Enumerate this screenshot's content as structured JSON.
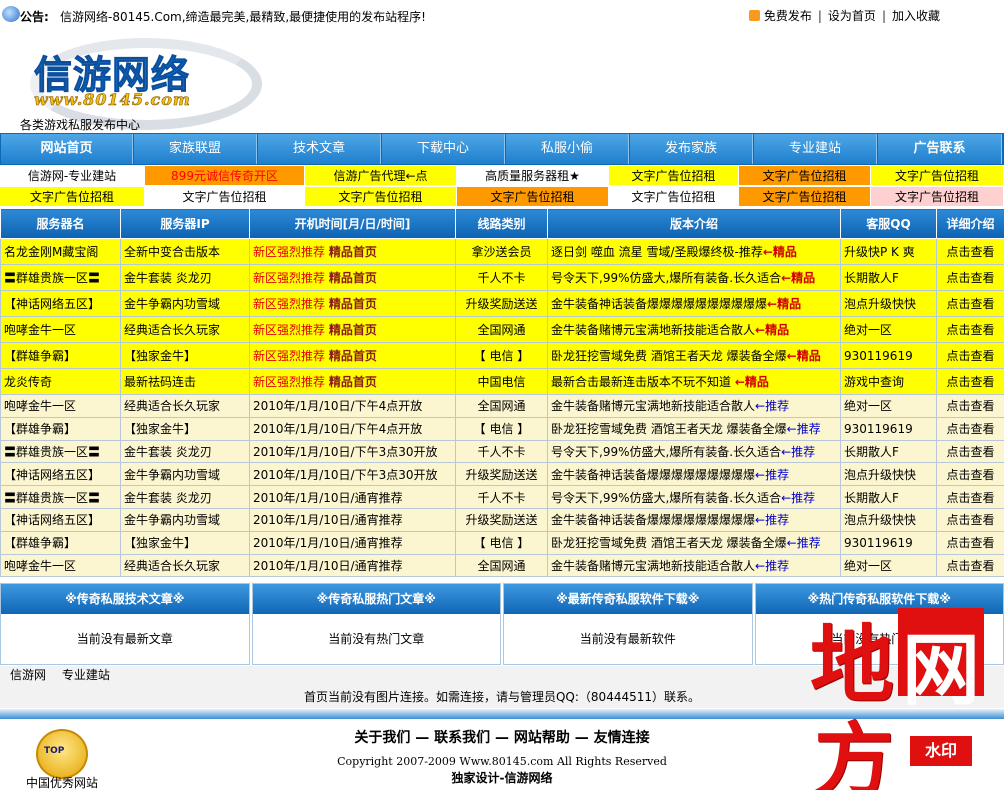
{
  "topbar": {
    "notice_label": "公告:",
    "notice_text": "信游网络-80145.Com,缔造最完美,最精致,最便捷使用的发布站程序!",
    "links": [
      "免费发布",
      "设为首页",
      "加入收藏"
    ]
  },
  "logo": {
    "name": "信游网络",
    "url": "www.80145.com",
    "slogan": "各类游戏私服发布中心"
  },
  "nav": [
    "网站首页",
    "家族联盟",
    "技术文章",
    "下载中心",
    "私服小偷",
    "发布家族",
    "专业建站",
    "广告联系"
  ],
  "ads": {
    "row1": [
      {
        "label": "信游网-专业建站",
        "bg": "#ffffff",
        "color": "#000000"
      },
      {
        "label": "899元诚信传奇开区",
        "bg": "#ff9900",
        "color": "#ff0000"
      },
      {
        "label": "信游广告代理←点",
        "bg": "#ffff00",
        "color": "#000000"
      },
      {
        "label": "高质量服务器租★",
        "bg": "#ffffff",
        "color": "#000000"
      },
      {
        "label": "文字广告位招租",
        "bg": "#ffff00",
        "color": "#000000"
      },
      {
        "label": "文字广告位招租",
        "bg": "#ff9900",
        "color": "#000000"
      },
      {
        "label": "文字广告位招租",
        "bg": "#ffff00",
        "color": "#000000"
      }
    ],
    "row2": [
      {
        "label": "文字广告位招租",
        "bg": "#ffff00",
        "color": "#000000"
      },
      {
        "label": "文字广告位招租",
        "bg": "#ffffff",
        "color": "#000000"
      },
      {
        "label": "文字广告位招租",
        "bg": "#ffff00",
        "color": "#000000"
      },
      {
        "label": "文字广告位招租",
        "bg": "#ff9900",
        "color": "#000000"
      },
      {
        "label": "文字广告位招租",
        "bg": "#ffffff",
        "color": "#000000"
      },
      {
        "label": "文字广告位招租",
        "bg": "#ff9900",
        "color": "#000000"
      },
      {
        "label": "文字广告位招租",
        "bg": "#ffd0d0",
        "color": "#000000"
      }
    ]
  },
  "table": {
    "headers": [
      "服务器名",
      "服务器IP",
      "开机时间[月/日/时间]",
      "线路类别",
      "版本介绍",
      "客服QQ",
      "详细介绍"
    ],
    "vip_rows": [
      {
        "name": "名龙金刚M藏宝阁",
        "ip": "全新中变合击版本",
        "time_a": "新区强烈推荐",
        "time_b": "精品首页",
        "line": "拿沙送会员",
        "intro": "逐日剑 噬血 流星 雪域/圣殿爆终极-推荐",
        "intro_tag": "←精品",
        "qq": "升级快P K 爽",
        "detail": "点击查看"
      },
      {
        "name": "〓群雄贵族一区〓",
        "ip": "金牛套装 炎龙刃",
        "time_a": "新区强烈推荐",
        "time_b": "精品首页",
        "line": "千人不卡",
        "intro": "号令天下,99%仿盛大,爆所有装备.长久适合",
        "intro_tag": "←精品",
        "qq": "长期散人F",
        "detail": "点击查看"
      },
      {
        "name": "【神话网络五区】",
        "ip": "金牛争霸内功雪域",
        "time_a": "新区强烈推荐",
        "time_b": "精品首页",
        "line": "升级奖励送送",
        "intro": "金牛装备神话装备爆爆爆爆爆爆爆爆爆爆",
        "intro_tag": "←精品",
        "qq": "泡点升级快快",
        "detail": "点击查看"
      },
      {
        "name": "咆哮金牛一区",
        "ip": "经典适合长久玩家",
        "time_a": "新区强烈推荐",
        "time_b": "精品首页",
        "line": "全国网通",
        "intro": "金牛装备赌博元宝满地新技能适合散人",
        "intro_tag": "←精品",
        "qq": "绝对一区",
        "detail": "点击查看"
      },
      {
        "name": "【群雄争霸】",
        "ip": "【独家金牛】",
        "time_a": "新区强烈推荐",
        "time_b": "精品首页",
        "line": "【 电信 】",
        "intro": "卧龙狂挖雪域免费 酒馆王者天龙 爆装备全爆",
        "intro_tag": "←精品",
        "qq": "930119619",
        "detail": "点击查看"
      },
      {
        "name": "龙炎传奇",
        "ip": "最新祛码连击",
        "time_a": "新区强烈推荐",
        "time_b": "精品首页",
        "line": "中国电信",
        "intro": "最新合击最新连击版本不玩不知道 ",
        "intro_tag": "←精品",
        "qq": "游戏中查询",
        "detail": "点击查看"
      }
    ],
    "normal_rows": [
      {
        "name": "咆哮金牛一区",
        "ip": "经典适合长久玩家",
        "time": "2010年/1月/10日/下午4点开放",
        "line": "全国网通",
        "intro": "金牛装备赌博元宝满地新技能适合散人",
        "intro_tag": "←推荐",
        "qq": "绝对一区",
        "detail": "点击查看"
      },
      {
        "name": "【群雄争霸】",
        "ip": "【独家金牛】",
        "time": "2010年/1月/10日/下午4点开放",
        "line": "【 电信 】",
        "intro": "卧龙狂挖雪域免费 酒馆王者天龙 爆装备全爆",
        "intro_tag": "←推荐",
        "qq": "930119619",
        "detail": "点击查看"
      },
      {
        "name": "〓群雄贵族一区〓",
        "ip": "金牛套装 炎龙刃",
        "time": "2010年/1月/10日/下午3点30开放",
        "line": "千人不卡",
        "intro": "号令天下,99%仿盛大,爆所有装备.长久适合",
        "intro_tag": "←推荐",
        "qq": "长期散人F",
        "detail": "点击查看"
      },
      {
        "name": "【神话网络五区】",
        "ip": "金牛争霸内功雪域",
        "time": "2010年/1月/10日/下午3点30开放",
        "line": "升级奖励送送",
        "intro": "金牛装备神话装备爆爆爆爆爆爆爆爆爆",
        "intro_tag": "←推荐",
        "qq": "泡点升级快快",
        "detail": "点击查看"
      },
      {
        "name": "〓群雄贵族一区〓",
        "ip": "金牛套装 炎龙刃",
        "time": "2010年/1月/10日/通宵推荐",
        "line": "千人不卡",
        "intro": "号令天下,99%仿盛大,爆所有装备.长久适合",
        "intro_tag": "←推荐",
        "qq": "长期散人F",
        "detail": "点击查看"
      },
      {
        "name": "【神话网络五区】",
        "ip": "金牛争霸内功雪域",
        "time": "2010年/1月/10日/通宵推荐",
        "line": "升级奖励送送",
        "intro": "金牛装备神话装备爆爆爆爆爆爆爆爆爆",
        "intro_tag": "←推荐",
        "qq": "泡点升级快快",
        "detail": "点击查看"
      },
      {
        "name": "【群雄争霸】",
        "ip": "【独家金牛】",
        "time": "2010年/1月/10日/通宵推荐",
        "line": "【 电信 】",
        "intro": "卧龙狂挖雪域免费 酒馆王者天龙 爆装备全爆",
        "intro_tag": "←推荐",
        "qq": "930119619",
        "detail": "点击查看"
      },
      {
        "name": "咆哮金牛一区",
        "ip": "经典适合长久玩家",
        "time": "2010年/1月/10日/通宵推荐",
        "line": "全国网通",
        "intro": "金牛装备赌博元宝满地新技能适合散人",
        "intro_tag": "←推荐",
        "qq": "绝对一区",
        "detail": "点击查看"
      }
    ]
  },
  "panels": [
    {
      "title": "※传奇私服技术文章※",
      "body": "当前没有最新文章"
    },
    {
      "title": "※传奇私服热门文章※",
      "body": "当前没有热门文章"
    },
    {
      "title": "※最新传奇私服软件下载※",
      "body": "当前没有最新软件"
    },
    {
      "title": "※热门传奇私服软件下载※",
      "body": "当前没有热门软件"
    }
  ],
  "links_row": [
    "信游网",
    "专业建站"
  ],
  "no_image_links": "首页当前没有图片连接。如需连接，请与管理员QQ:（80444511）联系。",
  "footer": {
    "links": "关于我们 — 联系我们 — 网站帮助 — 友情连接",
    "copyright": "Copyright 2007-2009 Www.80145.com All Rights Reserved",
    "design": "独家设计-信游网络",
    "badge_text": "TOP",
    "badge_caption": "中国优秀网站"
  },
  "watermark": {
    "chars": [
      "地",
      "网",
      "方"
    ],
    "tag": "水印"
  }
}
